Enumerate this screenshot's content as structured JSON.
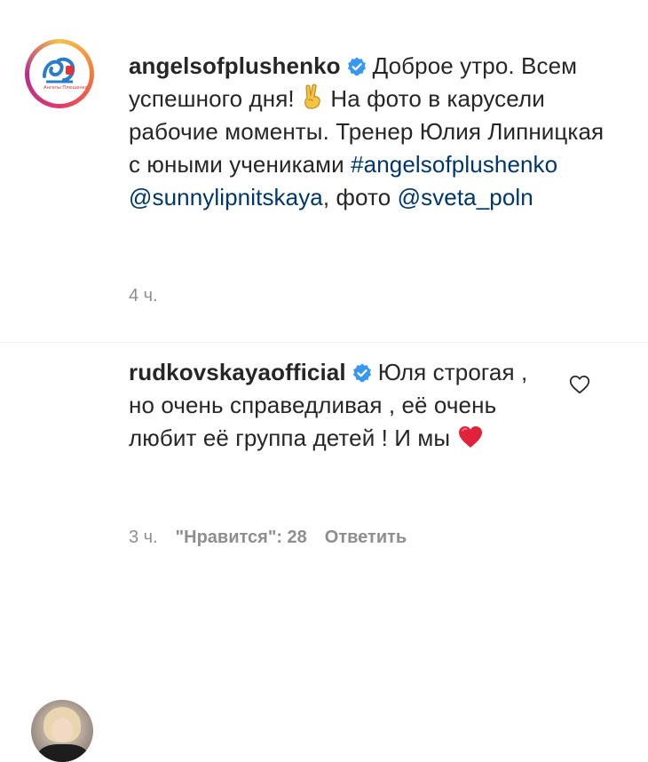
{
  "post": {
    "username": "angelsofplushenko",
    "avatar_brand_text": "Ангелы Плющенко",
    "text_part1": "Доброе утро. Всем успешного дня!",
    "emoji": "victory-hand",
    "text_part2": "На фото в карусели рабочие моменты. Тренер Юлия Липницкая с юными учениками",
    "hashtag": "#angelsofplushenko",
    "mention1": "@sunnylipnitskaya",
    "text_part3": ", фото",
    "mention2": "@sveta_poln",
    "time": "4 ч."
  },
  "comment": {
    "username": "rudkovskayaofficial",
    "text": "Юля строгая , но очень справедливая , её очень любит её группа детей ! И мы",
    "emoji": "red-heart",
    "time": "3 ч.",
    "likes_label": "\"Нравится\": 28",
    "reply_label": "Ответить"
  },
  "colors": {
    "text": "#262626",
    "meta": "#8e8e8e",
    "link": "#00376b",
    "verified": "#3897f0",
    "heart": "#ed4956"
  }
}
